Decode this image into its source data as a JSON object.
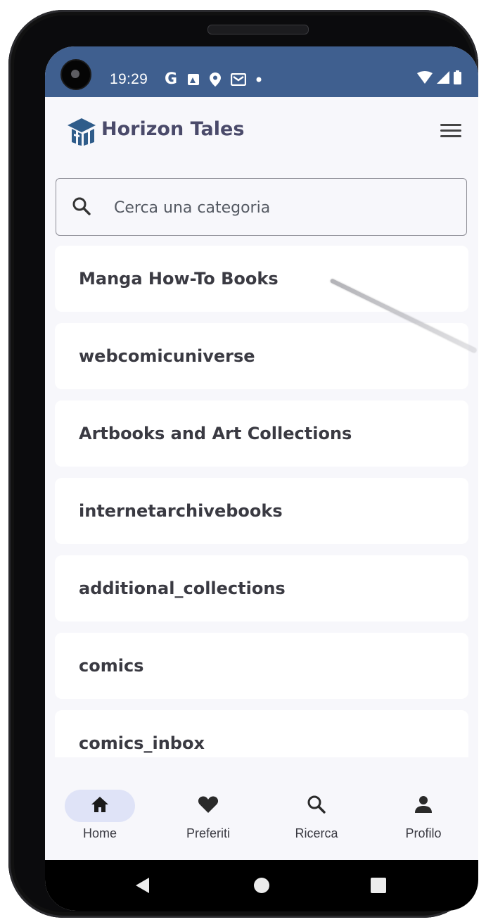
{
  "status_bar": {
    "time": "19:29",
    "left_icons": [
      "google-icon",
      "photo-icon",
      "location-icon",
      "mail-icon",
      "dot-icon"
    ],
    "right_icons": [
      "wifi-icon",
      "signal-icon",
      "battery-icon"
    ]
  },
  "app_bar": {
    "title": "Horizon Tales",
    "menu_icon": "hamburger-icon"
  },
  "search": {
    "placeholder": "Cerca una categoria",
    "icon": "search-icon"
  },
  "categories": [
    "Manga How-To Books",
    "webcomicuniverse",
    "Artbooks and Art Collections",
    "internetarchivebooks",
    "additional_collections",
    "comics",
    "comics_inbox"
  ],
  "bottom_nav": [
    {
      "label": "Home",
      "icon": "home-icon",
      "active": true
    },
    {
      "label": "Preferiti",
      "icon": "heart-icon",
      "active": false
    },
    {
      "label": "Ricerca",
      "icon": "search-icon",
      "active": false
    },
    {
      "label": "Profilo",
      "icon": "person-icon",
      "active": false
    }
  ],
  "colors": {
    "status_bar": "#3f5f8f",
    "screen_bg": "#f7f7fb",
    "card_bg": "#ffffff",
    "active_pill": "#dfe3f7",
    "text": "#3a3a42",
    "brand": "#4a4a6a"
  }
}
